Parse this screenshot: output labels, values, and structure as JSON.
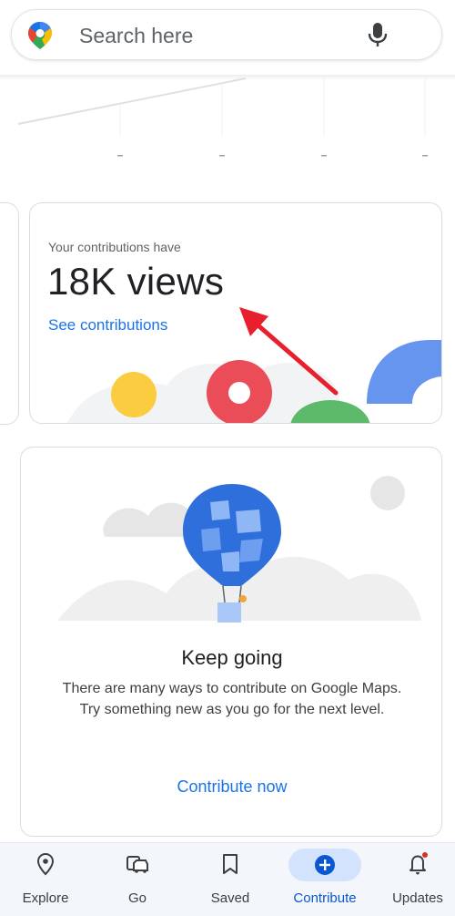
{
  "search": {
    "placeholder": "Search here"
  },
  "contributions_card": {
    "subtitle": "Your contributions have",
    "views": "18K views",
    "link": "See contributions"
  },
  "goal_card": {
    "heading": "Keep going",
    "body": "There are many ways to contribute on Google Maps. Try something new as you go for the next level.",
    "cta": "Contribute now"
  },
  "bottom_nav": {
    "items": [
      {
        "label": "Explore",
        "icon": "location-pin-icon"
      },
      {
        "label": "Go",
        "icon": "commute-icon"
      },
      {
        "label": "Saved",
        "icon": "bookmark-icon"
      },
      {
        "label": "Contribute",
        "icon": "add-circle-icon",
        "active": true
      },
      {
        "label": "Updates",
        "icon": "bell-icon",
        "badge": true
      }
    ]
  },
  "colors": {
    "accent_blue": "#1a73e8",
    "active_pill": "#d3e3fd",
    "annotation_red": "#e8202e"
  }
}
